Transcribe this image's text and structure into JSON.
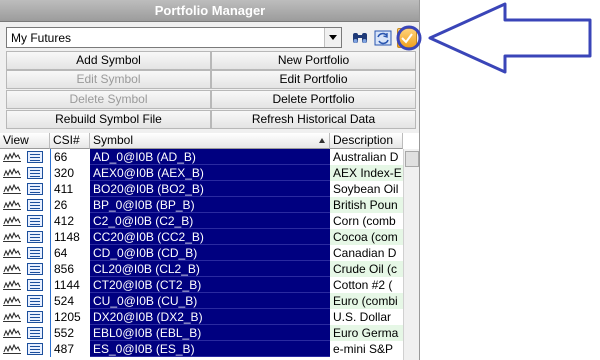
{
  "window": {
    "title": "Portfolio Manager"
  },
  "portfolio_select": {
    "value": "My Futures"
  },
  "toolbar": {
    "icons": [
      "binoculars-icon",
      "sync-icon",
      "checkmark-icon"
    ]
  },
  "buttons": {
    "add_symbol": "Add Symbol",
    "new_portfolio": "New Portfolio",
    "edit_symbol": "Edit Symbol",
    "edit_portfolio": "Edit Portfolio",
    "delete_symbol": "Delete Symbol",
    "delete_portfolio": "Delete Portfolio",
    "rebuild_symbol_file": "Rebuild Symbol File",
    "refresh_historical_data": "Refresh Historical Data"
  },
  "table": {
    "headers": {
      "view": "View",
      "csi": "CSI#",
      "symbol": "Symbol",
      "description": "Description"
    },
    "rows": [
      {
        "csi": "66",
        "symbol": "AD_0@I0B  (AD_B)",
        "description": "Australian D"
      },
      {
        "csi": "320",
        "symbol": "AEX0@I0B  (AEX_B)",
        "description": "AEX Index-E"
      },
      {
        "csi": "411",
        "symbol": "BO20@I0B  (BO2_B)",
        "description": "Soybean Oil"
      },
      {
        "csi": "26",
        "symbol": "BP_0@I0B  (BP_B)",
        "description": "British Poun"
      },
      {
        "csi": "412",
        "symbol": "C2_0@I0B  (C2_B)",
        "description": "Corn (comb"
      },
      {
        "csi": "1148",
        "symbol": "CC20@I0B  (CC2_B)",
        "description": "Cocoa (com"
      },
      {
        "csi": "64",
        "symbol": "CD_0@I0B  (CD_B)",
        "description": "Canadian D"
      },
      {
        "csi": "856",
        "symbol": "CL20@I0B  (CL2_B)",
        "description": "Crude Oil (c"
      },
      {
        "csi": "1144",
        "symbol": "CT20@I0B  (CT2_B)",
        "description": "Cotton #2 ("
      },
      {
        "csi": "524",
        "symbol": "CU_0@I0B  (CU_B)",
        "description": "Euro (combi"
      },
      {
        "csi": "1205",
        "symbol": "DX20@I0B  (DX2_B)",
        "description": "U.S. Dollar"
      },
      {
        "csi": "552",
        "symbol": "EBL0@I0B  (EBL_B)",
        "description": "Euro Germa"
      },
      {
        "csi": "487",
        "symbol": "ES_0@I0B  (ES_B)",
        "description": "e-mini S&P"
      }
    ]
  },
  "colors": {
    "symbol_bg": "#000080",
    "annotation_arrow": "#3a45b8",
    "highlight_circle": "#3a45b8"
  }
}
